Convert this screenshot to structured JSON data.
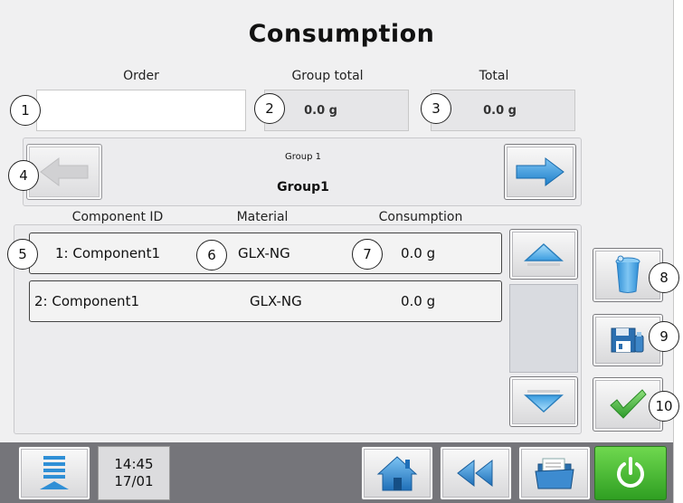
{
  "title": "Consumption",
  "order": {
    "label": "Order",
    "value": ""
  },
  "group_total": {
    "label": "Group total",
    "value": "0.0 g"
  },
  "total": {
    "label": "Total",
    "value": "0.0 g"
  },
  "group": {
    "caption": "Group 1",
    "name": "Group1"
  },
  "columns": {
    "component": "Component ID",
    "material": "Material",
    "consumption": "Consumption"
  },
  "rows": [
    {
      "component": "1: Component1",
      "material": "GLX-NG",
      "consumption": "0.0 g"
    },
    {
      "component": "2: Component1",
      "material": "GLX-NG",
      "consumption": "0.0 g"
    }
  ],
  "callouts": [
    "1",
    "2",
    "3",
    "4",
    "5",
    "6",
    "7",
    "8",
    "9",
    "10"
  ],
  "status": {
    "time": "14:45",
    "date": "17/01"
  },
  "icons": {
    "prev": "arrow-left-icon",
    "next": "arrow-right-icon",
    "scroll_up": "chevron-up-icon",
    "scroll_down": "chevron-down-icon",
    "delete": "trash-icon",
    "save": "save-icon",
    "confirm": "checkmark-icon",
    "menu": "menu-icon",
    "home": "home-icon",
    "back": "rewind-icon",
    "folder": "folder-icon",
    "power": "power-icon"
  },
  "colors": {
    "accent_blue": "#2f8fd6",
    "confirm_green": "#3fb53a",
    "power_green": "#47bd2e"
  }
}
